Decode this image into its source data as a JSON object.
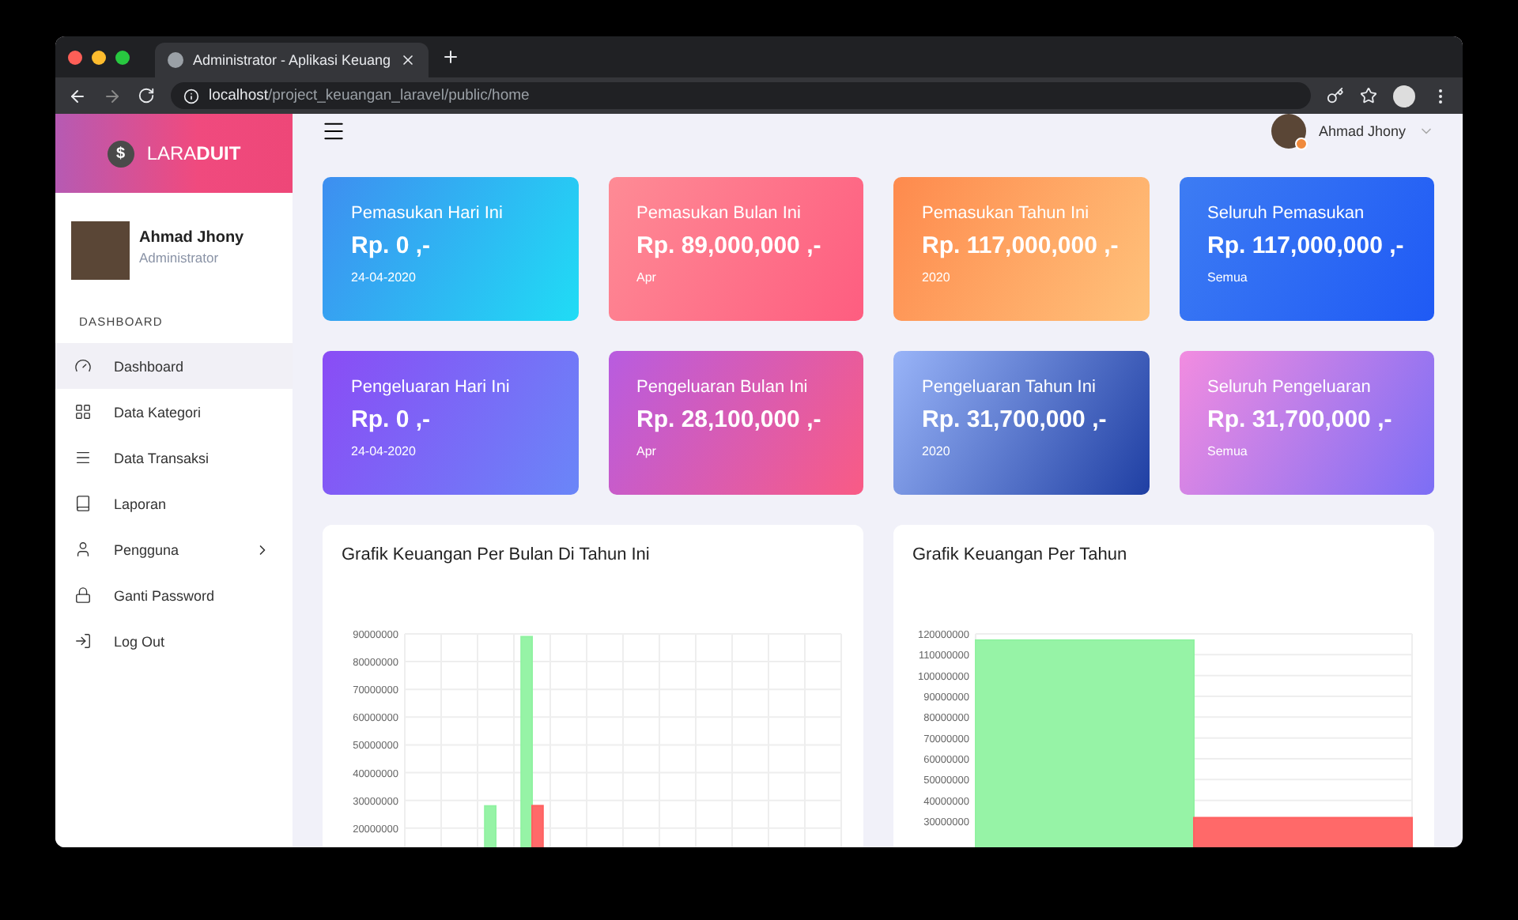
{
  "browser": {
    "tab_title": "Administrator - Aplikasi Keuang",
    "url_host": "localhost",
    "url_path": "/project_keuangan_laravel/public/home"
  },
  "sidebar": {
    "logo": "$",
    "brand": "LARA**DUIT**",
    "user": {
      "name": "Ahmad Jhony",
      "role": "Administrator"
    },
    "section": "DASHBOARD",
    "items": [
      {
        "label": "Dashboard",
        "selected": true,
        "expandable": false
      },
      {
        "label": "Data Kategori",
        "selected": false,
        "expandable": false
      },
      {
        "label": "Data Transaksi",
        "selected": false,
        "expandable": false
      },
      {
        "label": "Laporan",
        "selected": false,
        "expandable": false
      },
      {
        "label": "Pengguna",
        "selected": false,
        "expandable": true
      },
      {
        "label": "Ganti Password",
        "selected": false,
        "expandable": false
      },
      {
        "label": "Log Out",
        "selected": false,
        "expandable": false
      }
    ]
  },
  "topbar": {
    "user_name": "Ahmad Jhony"
  },
  "stat_cards": [
    {
      "title": "Pemasukan Hari Ini",
      "amount": "Rp. 0 ,-",
      "note": "24-04-2020"
    },
    {
      "title": "Pemasukan Bulan Ini",
      "amount": "Rp. 89,000,000 ,-",
      "note": "Apr"
    },
    {
      "title": "Pemasukan Tahun Ini",
      "amount": "Rp. 117,000,000 ,-",
      "note": "2020"
    },
    {
      "title": "Seluruh Pemasukan",
      "amount": "Rp. 117,000,000 ,-",
      "note": "Semua"
    },
    {
      "title": "Pengeluaran Hari Ini",
      "amount": "Rp. 0 ,-",
      "note": "24-04-2020"
    },
    {
      "title": "Pengeluaran Bulan Ini",
      "amount": "Rp. 28,100,000 ,-",
      "note": "Apr"
    },
    {
      "title": "Pengeluaran Tahun Ini",
      "amount": "Rp. 31,700,000 ,-",
      "note": "2020"
    },
    {
      "title": "Seluruh Pengeluaran",
      "amount": "Rp. 31,700,000 ,-",
      "note": "Semua"
    }
  ],
  "charts": [
    {
      "chart_data": {
        "type": "bar",
        "title": "Grafik Keuangan Per Bulan Di Tahun Ini",
        "grid": true,
        "ylim": [
          0,
          90000000
        ],
        "yticks": [
          20000000,
          30000000,
          40000000,
          50000000,
          60000000,
          70000000,
          80000000,
          90000000
        ],
        "series": [
          {
            "color": "#90f2a1",
            "values": [
              null,
              null,
              28000000,
              89000000,
              null,
              null,
              null,
              null,
              null,
              null,
              null,
              null
            ]
          },
          {
            "color": "#ff6161",
            "values": [
              null,
              null,
              null,
              28100000,
              null,
              null,
              null,
              null,
              null,
              null,
              null,
              null
            ]
          }
        ]
      }
    },
    {
      "chart_data": {
        "type": "bar",
        "title": "Grafik Keuangan Per Tahun",
        "grid": true,
        "ylim": [
          0,
          120000000
        ],
        "yticks": [
          30000000,
          40000000,
          50000000,
          60000000,
          70000000,
          80000000,
          90000000,
          100000000,
          110000000,
          120000000
        ],
        "series": [
          {
            "color": "#90f2a1",
            "values": [
              117000000
            ]
          },
          {
            "color": "#ff6161",
            "values": [
              31700000
            ]
          }
        ]
      }
    }
  ]
}
